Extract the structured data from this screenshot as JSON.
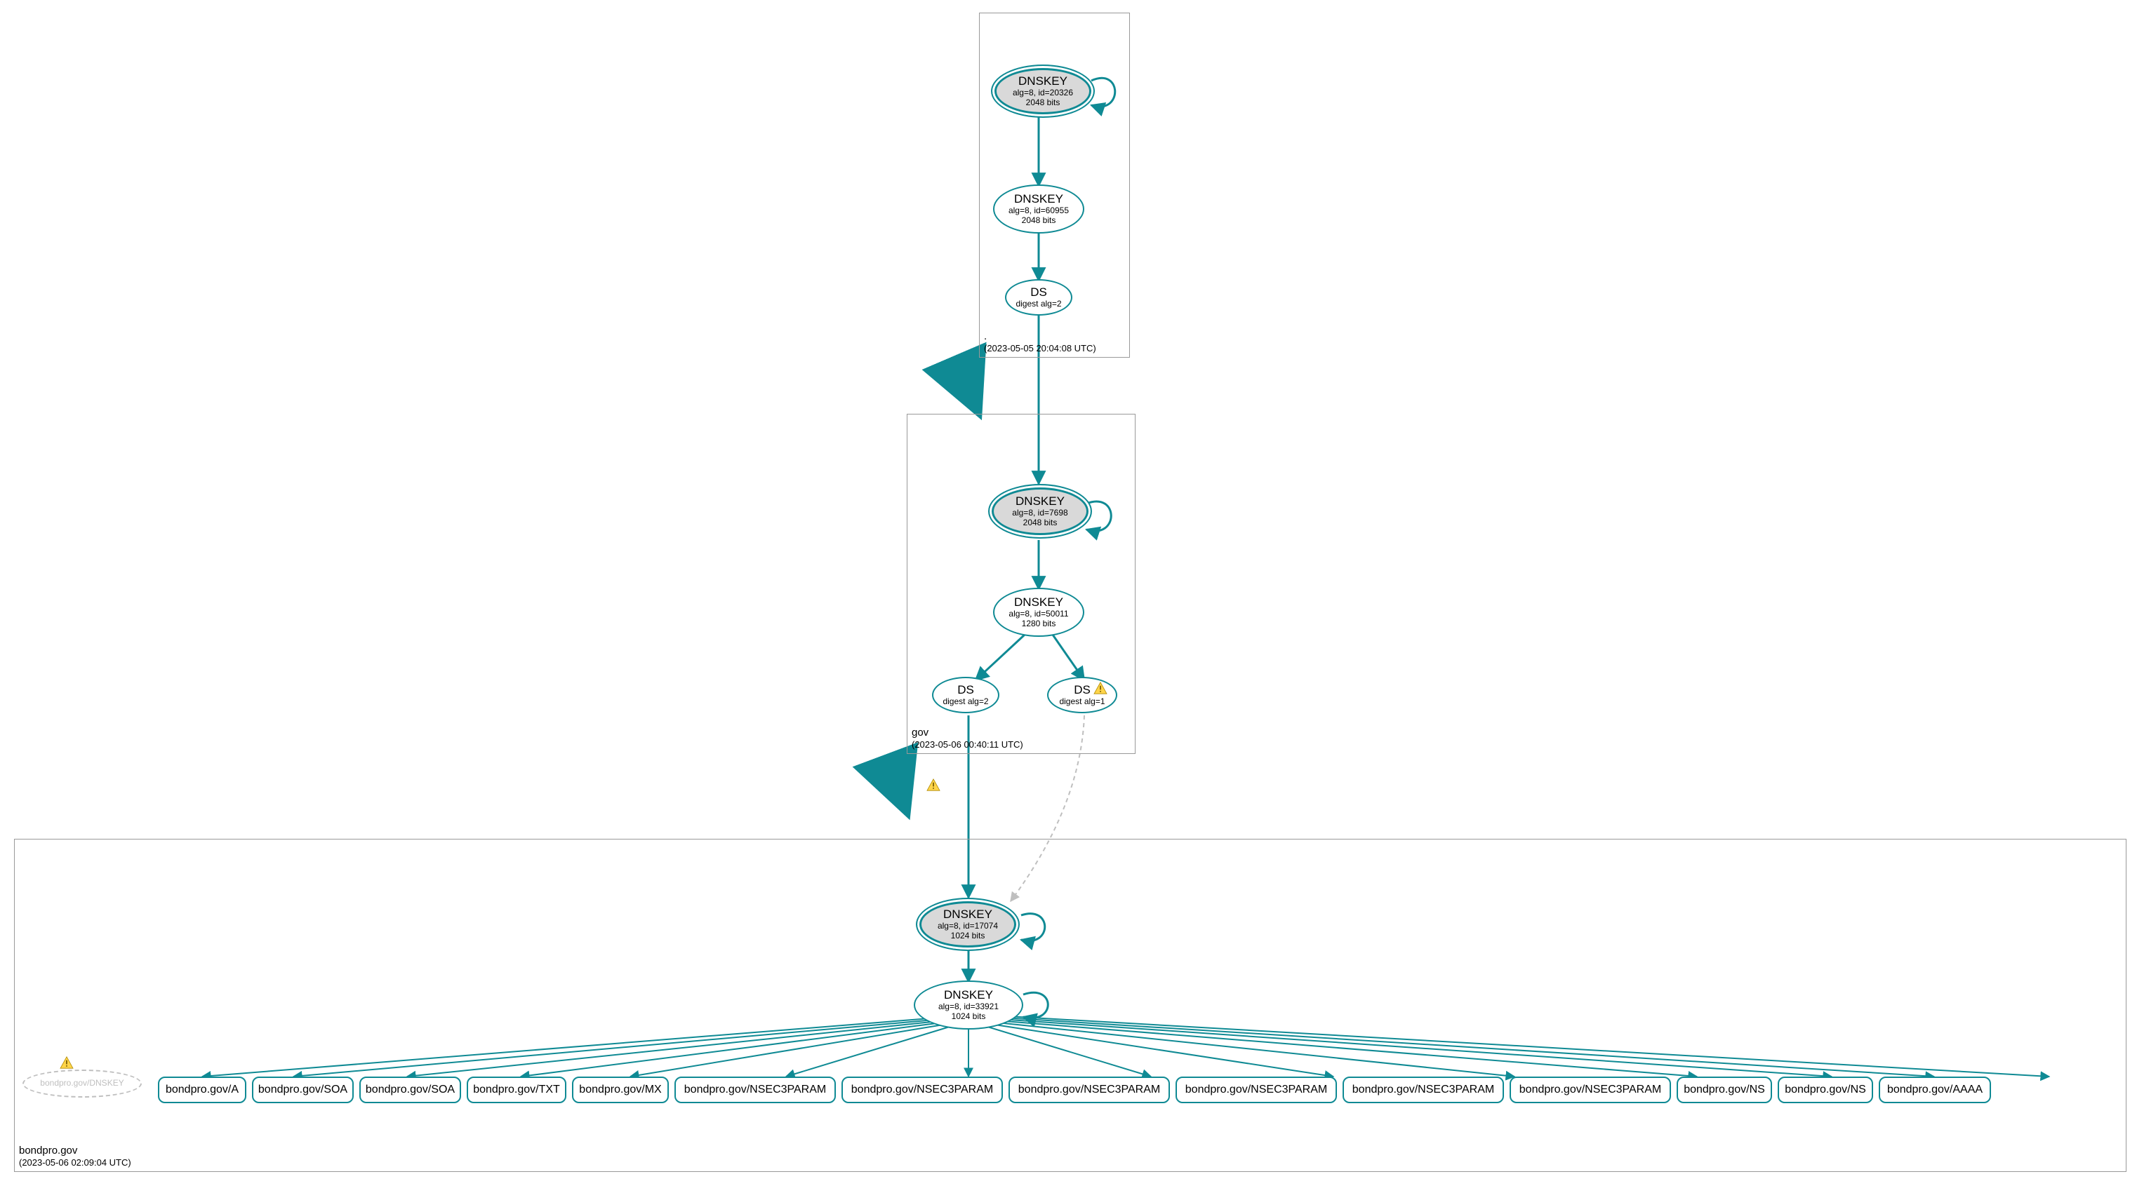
{
  "colors": {
    "edge": "#0f8a94",
    "edgeFaint": "#bfbfbf",
    "zone": "#999999"
  },
  "zones": {
    "root": {
      "name": ".",
      "timestamp": "(2023-05-05 20:04:08 UTC)"
    },
    "gov": {
      "name": "gov",
      "timestamp": "(2023-05-06 00:40:11 UTC)"
    },
    "domain": {
      "name": "bondpro.gov",
      "timestamp": "(2023-05-06 02:09:04 UTC)"
    }
  },
  "nodes": {
    "root_ksk": {
      "title": "DNSKEY",
      "l1": "alg=8, id=20326",
      "l2": "2048 bits"
    },
    "root_zsk": {
      "title": "DNSKEY",
      "l1": "alg=8, id=60955",
      "l2": "2048 bits"
    },
    "root_ds": {
      "title": "DS",
      "l1": "digest alg=2"
    },
    "gov_ksk": {
      "title": "DNSKEY",
      "l1": "alg=8, id=7698",
      "l2": "2048 bits"
    },
    "gov_zsk": {
      "title": "DNSKEY",
      "l1": "alg=8, id=50011",
      "l2": "1280 bits"
    },
    "gov_ds1": {
      "title": "DS",
      "l1": "digest alg=2"
    },
    "gov_ds2": {
      "title": "DS",
      "l1": "digest alg=1"
    },
    "dom_ksk": {
      "title": "DNSKEY",
      "l1": "alg=8, id=17074",
      "l2": "1024 bits"
    },
    "dom_zsk": {
      "title": "DNSKEY",
      "l1": "alg=8, id=33921",
      "l2": "1024 bits"
    },
    "dom_missing": {
      "title": "bondpro.gov/DNSKEY"
    }
  },
  "rrsets": [
    "bondpro.gov/A",
    "bondpro.gov/SOA",
    "bondpro.gov/SOA",
    "bondpro.gov/TXT",
    "bondpro.gov/MX",
    "bondpro.gov/NSEC3PARAM",
    "bondpro.gov/NSEC3PARAM",
    "bondpro.gov/NSEC3PARAM",
    "bondpro.gov/NSEC3PARAM",
    "bondpro.gov/NSEC3PARAM",
    "bondpro.gov/NSEC3PARAM",
    "bondpro.gov/NS",
    "bondpro.gov/NS",
    "bondpro.gov/AAAA"
  ]
}
